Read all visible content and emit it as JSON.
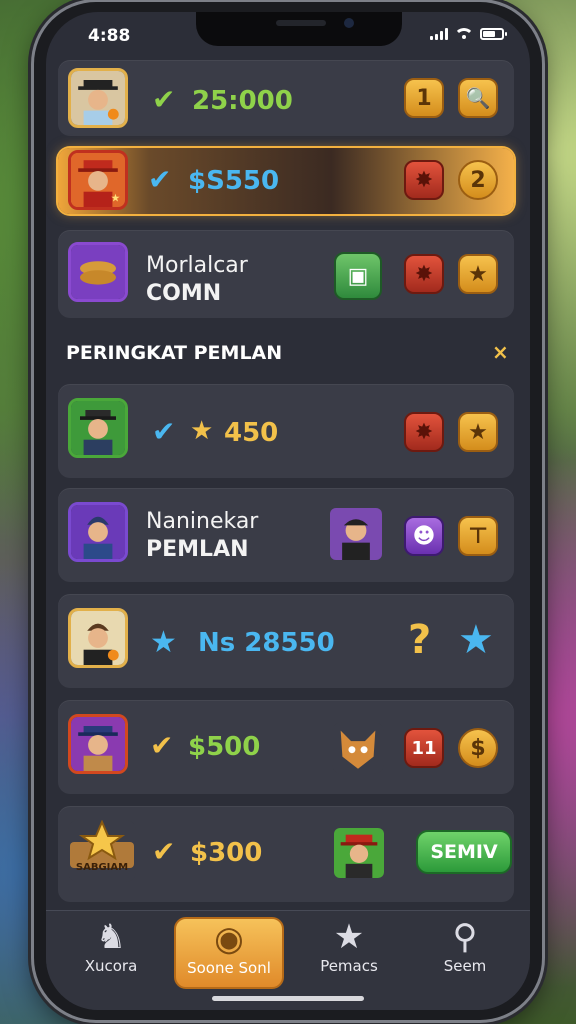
{
  "status_bar": {
    "time": "4:88"
  },
  "rows": [
    {
      "value": "25:000",
      "badges": [
        "1",
        "🔍"
      ]
    },
    {
      "value": "$S550",
      "badges": [
        "",
        "2"
      ]
    },
    {
      "name_line1": "Morlalcar",
      "name_line2": "COMN"
    },
    {
      "value": "450"
    },
    {
      "name_line1": "Naninekar",
      "name_line2": "PEMLAN"
    },
    {
      "value": "Ns 28550",
      "badges": [
        "?"
      ]
    },
    {
      "value": "$500",
      "badges": [
        "11"
      ]
    },
    {
      "value": "$300",
      "avatar_label": "SABGIAM",
      "button": "SEMIV"
    }
  ],
  "section": {
    "title": "PERINGKAT PEMLAN",
    "close": "×"
  },
  "tabs": [
    {
      "label": "Xucora",
      "icon": "horse-icon"
    },
    {
      "label": "Soone Sonl",
      "icon": "glasses-coin-icon"
    },
    {
      "label": "Pemacs",
      "icon": "star-icon"
    },
    {
      "label": "Seem",
      "icon": "search-icon"
    }
  ],
  "colors": {
    "accent": "#f2c14a",
    "value_green": "#8fd24a",
    "value_blue": "#4ab7f0",
    "panel": "#3a3c47"
  }
}
